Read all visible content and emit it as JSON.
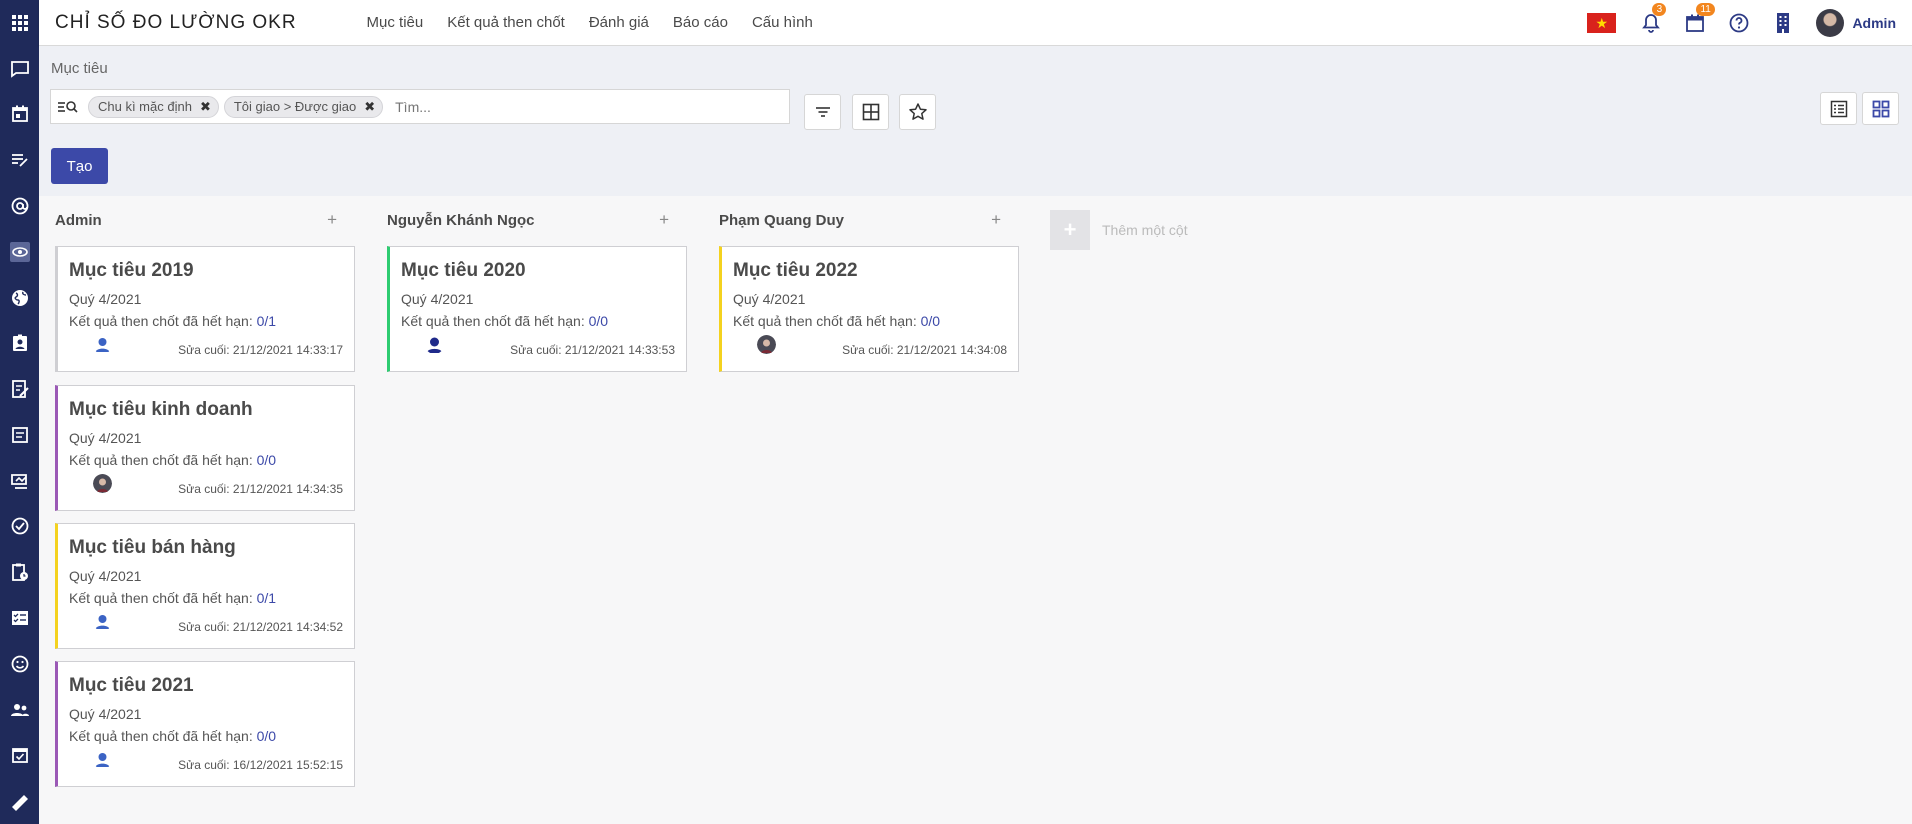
{
  "app": {
    "title": "CHỈ SỐ ĐO LƯỜNG OKR"
  },
  "top_menu": [
    "Mục tiêu",
    "Kết quả then chốt",
    "Đánh giá",
    "Báo cáo",
    "Cấu hình"
  ],
  "top_right": {
    "notifications_count": "3",
    "activities_count": "11",
    "user_name": "Admin"
  },
  "breadcrumb": "Mục tiêu",
  "search": {
    "facets": [
      "Chu kì mặc định",
      "Tôi giao > Được giao"
    ],
    "placeholder": "Tìm..."
  },
  "create_label": "Tạo",
  "columns": [
    {
      "title": "Admin",
      "cards": [
        {
          "title": "Mục tiêu 2019",
          "period": "Quý 4/2021",
          "kr_label": "Kết quả then chốt đã hết hạn:",
          "kr_value": "0/1",
          "modified": "Sửa cuối: 21/12/2021 14:33:17",
          "accent": "#cfcfd3",
          "avatar": "default"
        },
        {
          "title": "Mục tiêu kinh doanh",
          "period": "Quý 4/2021",
          "kr_label": "Kết quả then chốt đã hết hạn:",
          "kr_value": "0/0",
          "modified": "Sửa cuối: 21/12/2021 14:34:35",
          "accent": "#9b59b6",
          "avatar": "photo"
        },
        {
          "title": "Mục tiêu bán hàng",
          "period": "Quý 4/2021",
          "kr_label": "Kết quả then chốt đã hết hạn:",
          "kr_value": "0/1",
          "modified": "Sửa cuối: 21/12/2021 14:34:52",
          "accent": "#f4d21f",
          "avatar": "default"
        },
        {
          "title": "Mục tiêu 2021",
          "period": "Quý 4/2021",
          "kr_label": "Kết quả then chốt đã hết hạn:",
          "kr_value": "0/0",
          "modified": "Sửa cuối: 16/12/2021 15:52:15",
          "accent": "#9b59b6",
          "avatar": "default"
        }
      ]
    },
    {
      "title": "Nguyễn Khánh Ngọc",
      "cards": [
        {
          "title": "Mục tiêu 2020",
          "period": "Quý 4/2021",
          "kr_label": "Kết quả then chốt đã hết hạn:",
          "kr_value": "0/0",
          "modified": "Sửa cuối: 21/12/2021 14:33:53",
          "accent": "#2ecc71",
          "avatar": "dark"
        }
      ]
    },
    {
      "title": "Phạm Quang Duy",
      "cards": [
        {
          "title": "Mục tiêu 2022",
          "period": "Quý 4/2021",
          "kr_label": "Kết quả then chốt đã hết hạn:",
          "kr_value": "0/0",
          "modified": "Sửa cuối: 21/12/2021 14:34:08",
          "accent": "#f4d21f",
          "avatar": "photo"
        }
      ]
    }
  ],
  "add_column_label": "Thêm một cột",
  "sidebar_icons": [
    "discuss-icon",
    "calendar-icon",
    "notes-icon",
    "at-icon",
    "okr-icon",
    "website-icon",
    "contacts-icon",
    "survey-icon",
    "forms-icon",
    "presentation-icon",
    "check-circle-icon",
    "clipboard-clock-icon",
    "checklist-icon",
    "smile-icon",
    "people-icon",
    "calendar-check-icon",
    "ruler-icon"
  ],
  "colors": {
    "sidebar": "#1f2a5a",
    "primary": "#3c49a8",
    "badge": "#f2861f"
  }
}
